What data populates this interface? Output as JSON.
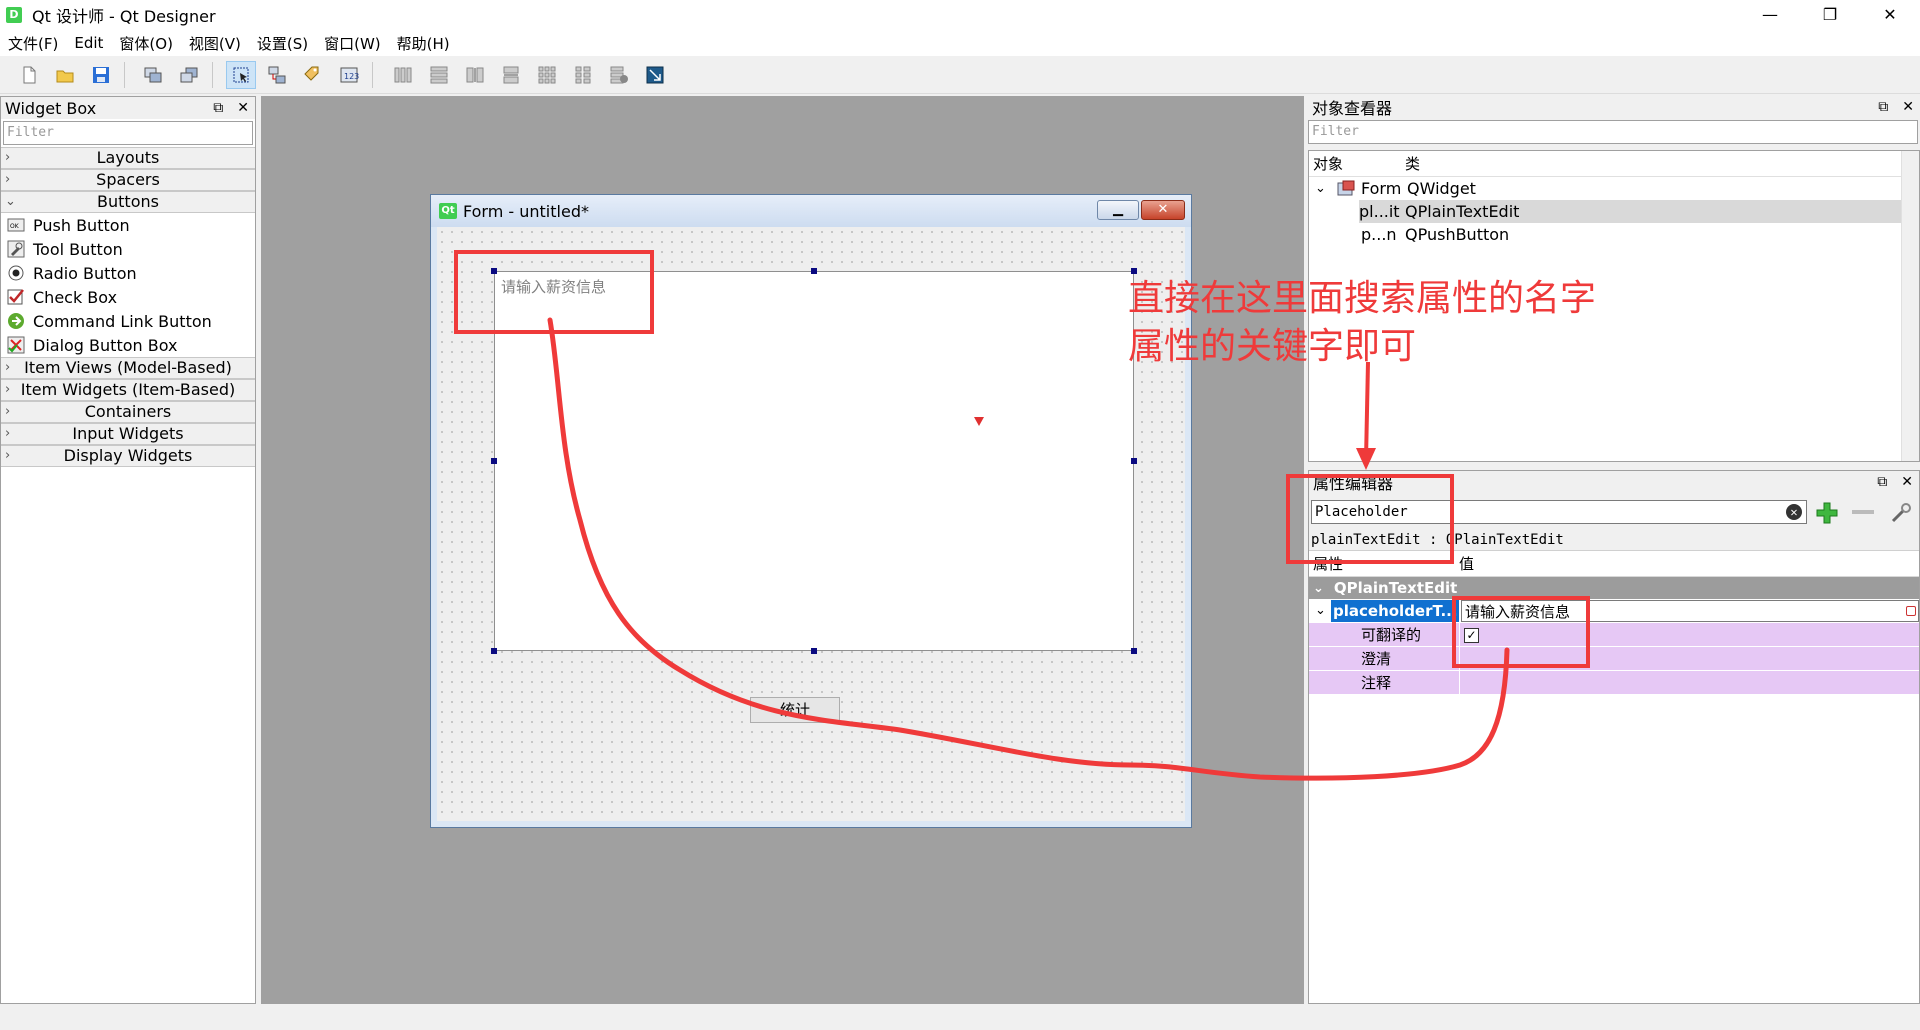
{
  "window": {
    "title": "Qt 设计师 - Qt Designer",
    "app_icon": "D",
    "controls": [
      "—",
      "❐",
      "✕"
    ]
  },
  "menu": [
    "文件(F)",
    "Edit",
    "窗体(O)",
    "视图(V)",
    "设置(S)",
    "窗口(W)",
    "帮助(H)"
  ],
  "widget_box": {
    "title": "Widget Box",
    "filter_placeholder": "Filter",
    "categories": {
      "layouts": "Layouts",
      "spacers": "Spacers",
      "buttons": "Buttons",
      "item_views": "Item Views (Model-Based)",
      "item_widgets": "Item Widgets (Item-Based)",
      "containers": "Containers",
      "input_widgets": "Input Widgets",
      "display_widgets": "Display Widgets"
    },
    "buttons": [
      "Push Button",
      "Tool Button",
      "Radio Button",
      "Check Box",
      "Command Link Button",
      "Dialog Button Box"
    ]
  },
  "form": {
    "title": "Form - untitled*",
    "qt_badge": "Qt",
    "placeholder": "请输入薪资信息",
    "push_button": "统计"
  },
  "object_inspector": {
    "title": "对象查看器",
    "filter_placeholder": "Filter",
    "col_object": "对象",
    "col_class": "类",
    "rows": [
      {
        "object": "Form",
        "class": "QWidget"
      },
      {
        "object": "pl...it",
        "class": "QPlainTextEdit"
      },
      {
        "object": "p...n",
        "class": "QPushButton"
      }
    ]
  },
  "property_editor": {
    "title": "属性编辑器",
    "search_value": "Placeholder",
    "class_line": "plainTextEdit : QPlainTextEdit",
    "col_property": "属性",
    "col_value": "值",
    "group": "QPlainTextEdit",
    "property_name": "placeholderT...",
    "property_value": "请输入薪资信息",
    "sub_rows": [
      {
        "name": "可翻译的",
        "value": "✓"
      },
      {
        "name": "澄清",
        "value": ""
      },
      {
        "name": "注释",
        "value": ""
      }
    ]
  },
  "annotation": {
    "line1": "直接在这里面搜索属性的名字",
    "line2": "属性的关键字即可",
    "color": "#ef3a3a"
  }
}
